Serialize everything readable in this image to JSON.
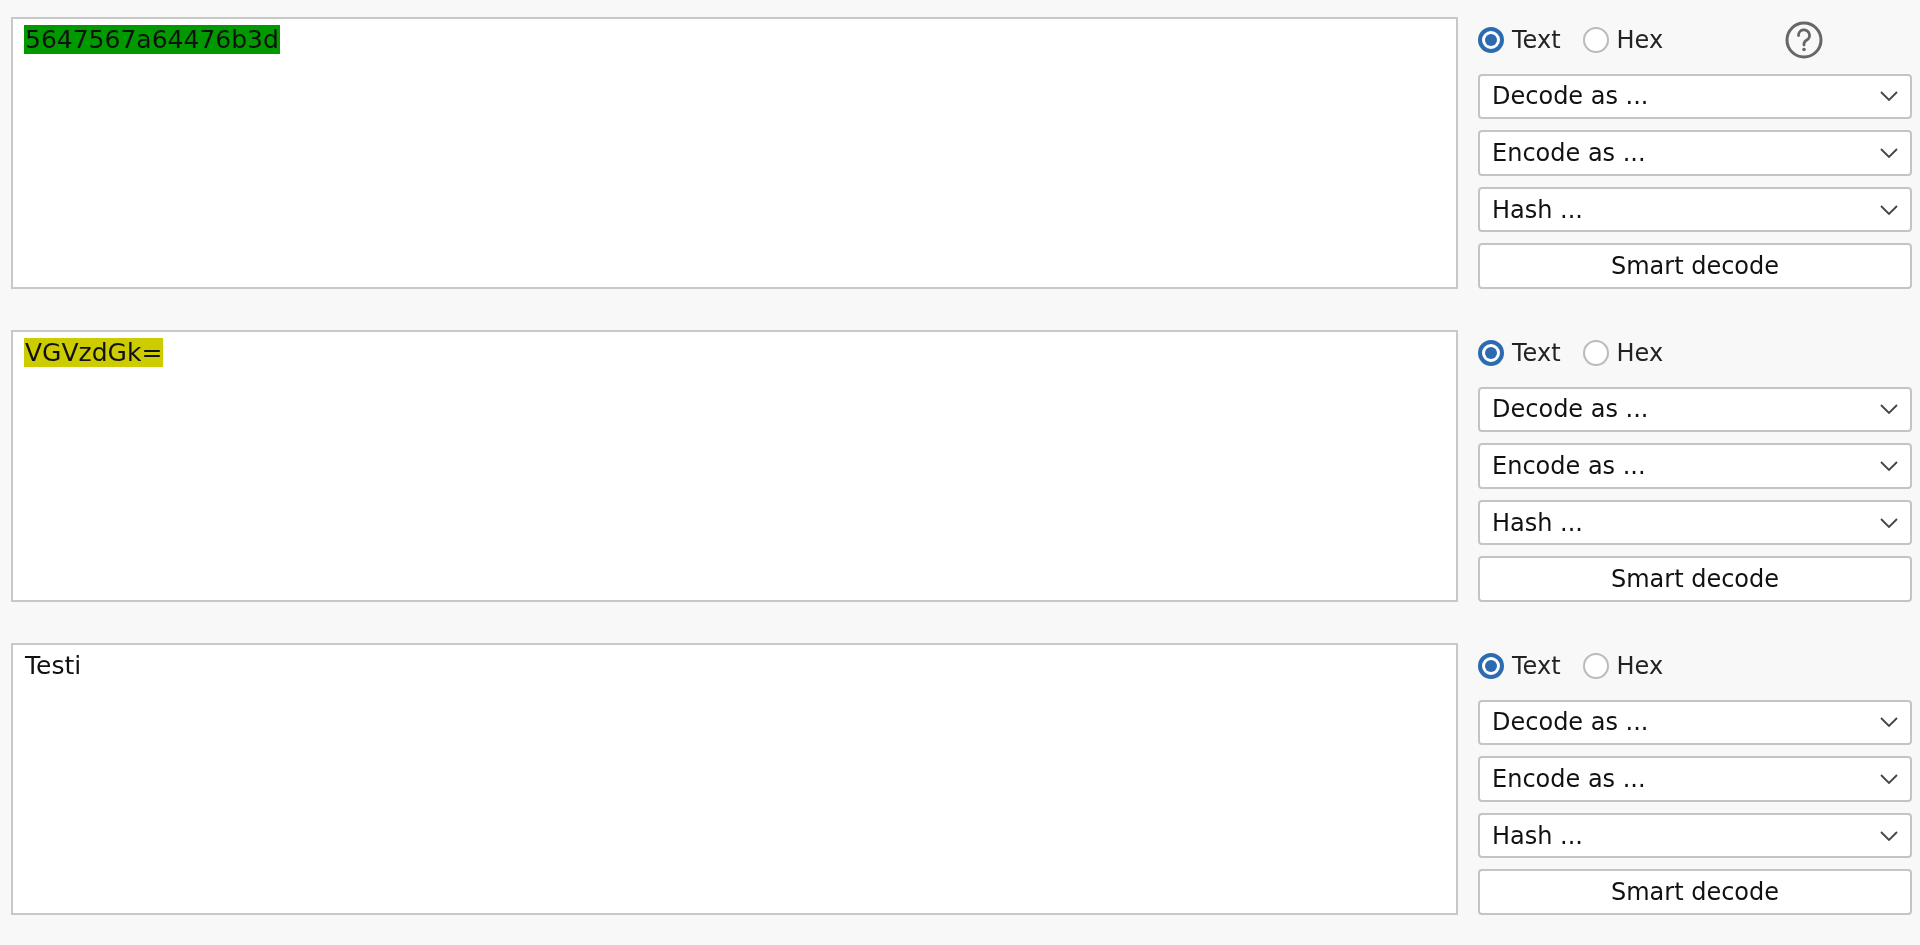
{
  "panels": [
    {
      "content": "5647567a64476b3d",
      "color": "#009900",
      "modes": [
        {
          "label": "Text",
          "selected": true
        },
        {
          "label": "Hex",
          "selected": false
        }
      ],
      "help": true,
      "dropdowns": [
        "Decode as ...",
        "Encode as ...",
        "Hash ..."
      ],
      "button": "Smart decode"
    },
    {
      "content": "VGVzdGk=",
      "color": "#cccc00",
      "modes": [
        {
          "label": "Text",
          "selected": true
        },
        {
          "label": "Hex",
          "selected": false
        }
      ],
      "help": false,
      "dropdowns": [
        "Decode as ...",
        "Encode as ...",
        "Hash ..."
      ],
      "button": "Smart decode"
    },
    {
      "content": "Testi",
      "modes": [
        {
          "label": "Text",
          "selected": true
        },
        {
          "label": "Hex",
          "selected": false
        }
      ],
      "help": false,
      "dropdowns": [
        "Decode as ...",
        "Encode as ...",
        "Hash ..."
      ],
      "button": "Smart decode"
    }
  ]
}
